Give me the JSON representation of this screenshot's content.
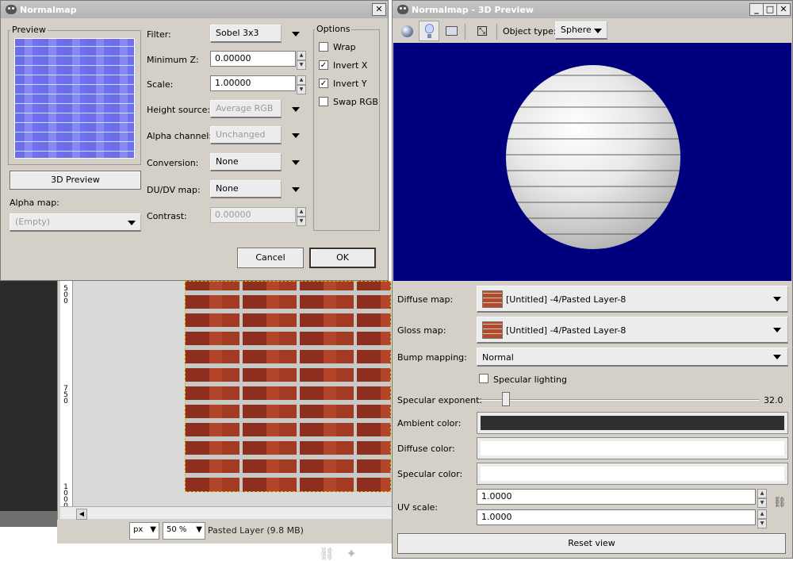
{
  "background_window": {
    "ruler_ticks": [
      [
        "5",
        "0",
        "0"
      ],
      [
        "7",
        "5",
        "0"
      ],
      [
        "1",
        "0",
        "0",
        "0"
      ]
    ],
    "unit": "px",
    "zoom": "50 %",
    "status": "Pasted Layer (9.8 MB)"
  },
  "normalmap_dialog": {
    "title": "Normalmap",
    "close_glyph": "✕",
    "preview_label": "Preview",
    "preview_button": "3D Preview",
    "alpha_map_label": "Alpha map:",
    "alpha_map_value": "(Empty)",
    "fields": {
      "filter": {
        "label": "Filter:",
        "value": "Sobel 3x3"
      },
      "minimum_z": {
        "label": "Minimum Z:",
        "value": "0.00000"
      },
      "scale": {
        "label": "Scale:",
        "value": "1.00000"
      },
      "height_source": {
        "label": "Height source:",
        "value": "Average RGB"
      },
      "alpha_channel": {
        "label": "Alpha channel:",
        "value": "Unchanged"
      },
      "conversion": {
        "label": "Conversion:",
        "value": "None"
      },
      "dudv_map": {
        "label": "DU/DV map:",
        "value": "None"
      },
      "contrast": {
        "label": "Contrast:",
        "value": "0.00000"
      }
    },
    "options_label": "Options",
    "options": [
      {
        "label": "Wrap",
        "checked": false
      },
      {
        "label": "Invert X",
        "checked": true
      },
      {
        "label": "Invert Y",
        "checked": true
      },
      {
        "label": "Swap RGB",
        "checked": false
      }
    ],
    "check_glyph": "✓",
    "cancel_button": "Cancel",
    "ok_button": "OK"
  },
  "preview_window": {
    "title": "Normalmap - 3D Preview",
    "win_buttons": {
      "minimize": "_",
      "maximize": "□",
      "close": "✕"
    },
    "object_type_label": "Object type:",
    "object_type_value": "Sphere",
    "diffuse_map_label": "Diffuse map:",
    "diffuse_map_value": "[Untitled] -4/Pasted Layer-8",
    "gloss_map_label": "Gloss map:",
    "gloss_map_value": "[Untitled] -4/Pasted Layer-8",
    "bump_mapping_label": "Bump mapping:",
    "bump_mapping_value": "Normal",
    "specular_lighting_label": "Specular lighting",
    "specular_lighting_checked": false,
    "specular_exponent_label": "Specular exponent:",
    "specular_exponent_value": "32.0",
    "specular_exponent_fraction": 0.098,
    "ambient_color_label": "Ambient color:",
    "ambient_color": "#2f2f2f",
    "diffuse_color_label": "Diffuse color:",
    "diffuse_color": "#ffffff",
    "specular_color_label": "Specular color:",
    "specular_color": "#ffffff",
    "uv_scale_label": "UV scale:",
    "uv_scale_u": "1.0000",
    "uv_scale_v": "1.0000",
    "reset_view_button": "Reset view",
    "view_background": "#00007f"
  }
}
